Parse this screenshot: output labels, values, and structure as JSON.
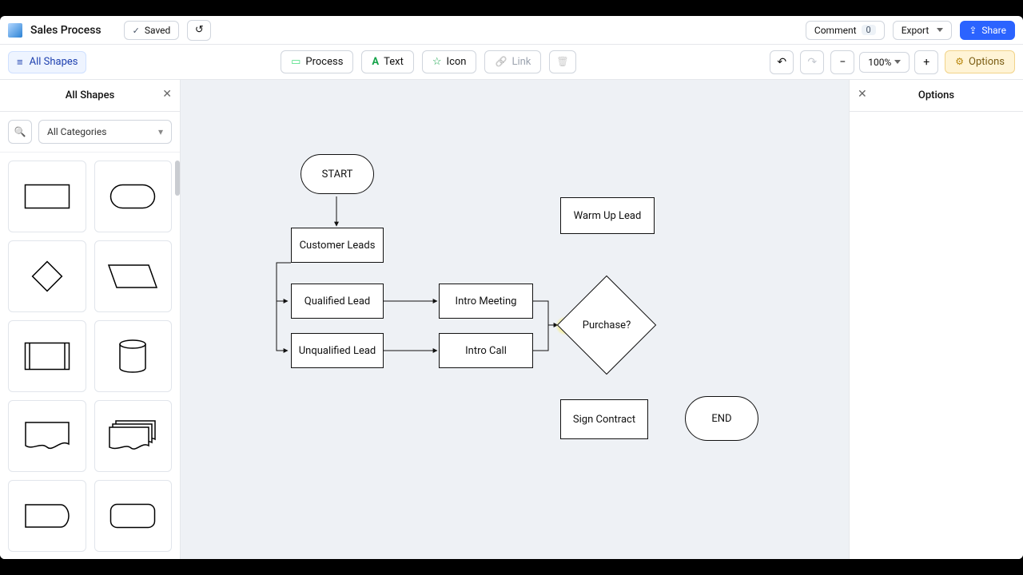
{
  "doc": {
    "title": "Sales Process",
    "savedLabel": "Saved"
  },
  "header": {
    "commentLabel": "Comment",
    "commentCount": "0",
    "exportLabel": "Export",
    "shareLabel": "Share"
  },
  "toolbar": {
    "allShapes": "All Shapes",
    "tools": {
      "process": "Process",
      "text": "Text",
      "icon": "Icon",
      "link": "Link"
    },
    "zoom": "100%",
    "options": "Options"
  },
  "panels": {
    "shapes": {
      "title": "All Shapes",
      "category": "All Categories"
    },
    "options": {
      "title": "Options"
    }
  },
  "flow": {
    "n_start": "START",
    "n_leads": "Customer Leads",
    "n_qual": "Qualified Lead",
    "n_unqual": "Unqualified Lead",
    "n_meeting": "Intro Meeting",
    "n_call": "Intro Call",
    "n_warm": "Warm Up Lead",
    "n_purchase": "Purchase?",
    "n_sign": "Sign Contract",
    "n_end": "END"
  },
  "chart_data": {
    "type": "flowchart",
    "title": "Sales Process",
    "nodes": [
      {
        "id": "start",
        "label": "START",
        "shape": "terminator"
      },
      {
        "id": "leads",
        "label": "Customer Leads",
        "shape": "process"
      },
      {
        "id": "qual",
        "label": "Qualified Lead",
        "shape": "process"
      },
      {
        "id": "unqual",
        "label": "Unqualified Lead",
        "shape": "process"
      },
      {
        "id": "meeting",
        "label": "Intro Meeting",
        "shape": "process"
      },
      {
        "id": "call",
        "label": "Intro Call",
        "shape": "process"
      },
      {
        "id": "warm",
        "label": "Warm Up Lead",
        "shape": "process"
      },
      {
        "id": "purchase",
        "label": "Purchase?",
        "shape": "decision"
      },
      {
        "id": "sign",
        "label": "Sign Contract",
        "shape": "process"
      },
      {
        "id": "end",
        "label": "END",
        "shape": "terminator"
      }
    ],
    "edges": [
      {
        "from": "start",
        "to": "leads"
      },
      {
        "from": "leads",
        "to": "qual"
      },
      {
        "from": "leads",
        "to": "unqual"
      },
      {
        "from": "qual",
        "to": "meeting"
      },
      {
        "from": "unqual",
        "to": "call"
      },
      {
        "from": "meeting",
        "to": "purchase"
      },
      {
        "from": "call",
        "to": "purchase"
      }
    ]
  }
}
